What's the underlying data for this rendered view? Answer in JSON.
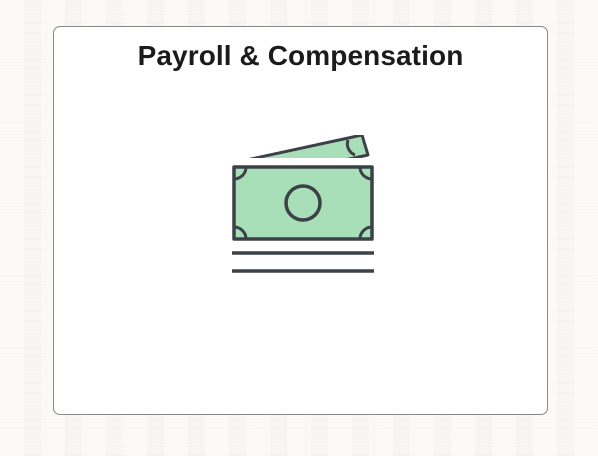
{
  "tile": {
    "title": "Payroll & Compensation",
    "icon": "cash-money-icon"
  },
  "colors": {
    "page_background": "#f7f6f3",
    "tile_background": "#ffffff",
    "tile_border": "#8a8785",
    "title_text": "#1b1b1b",
    "bill_fill": "#a8dfb8",
    "bill_stroke": "#3b4147"
  }
}
